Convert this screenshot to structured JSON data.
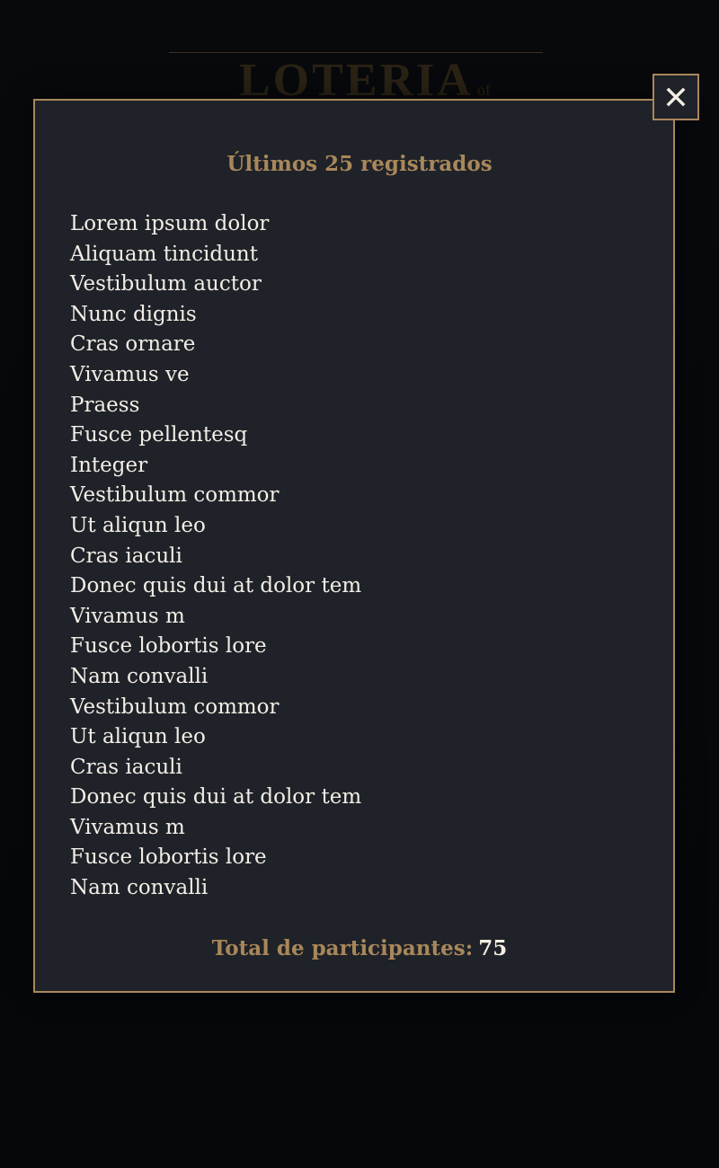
{
  "background": {
    "logo_text": "LOTERIA",
    "logo_suffix": "of"
  },
  "modal": {
    "close_icon": "close-icon",
    "title": "Últimos 25 registrados",
    "names": [
      "Lorem ipsum dolor",
      "Aliquam tincidunt",
      "Vestibulum auctor",
      "Nunc dignis",
      "Cras ornare",
      "Vivamus ve",
      "Praess",
      "Fusce pellentesq",
      "Integer",
      "Vestibulum commor",
      "Ut aliqun leo",
      "Cras iaculi",
      "Donec quis dui at dolor tem",
      "Vivamus m",
      "Fusce lobortis lore",
      "Nam convalli",
      "Vestibulum commor",
      "Ut aliqun leo",
      "Cras iaculi",
      "Donec quis dui at dolor tem",
      "Vivamus m",
      "Fusce lobortis lore",
      "Nam convalli"
    ],
    "total_label": "Total de participantes:",
    "total_value": "75"
  },
  "colors": {
    "accent_gold": "#a8875a",
    "panel_bg": "#1f2228",
    "page_bg": "#06080b",
    "text_light": "#f2eee6"
  }
}
